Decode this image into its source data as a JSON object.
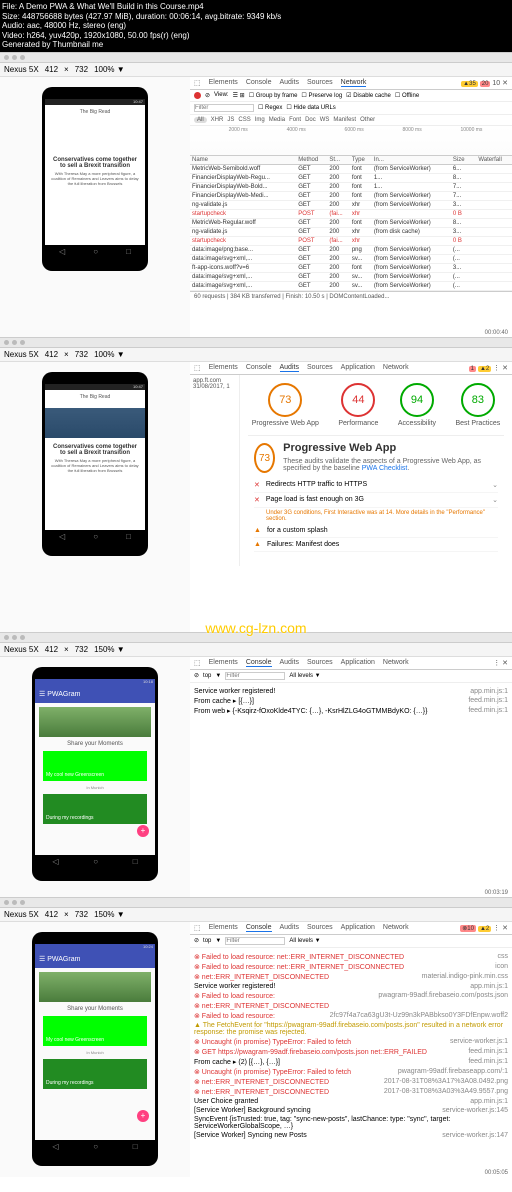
{
  "meta": {
    "file": "File: A Demo PWA & What We'll Build in this Course.mp4",
    "size": "Size: 448756688 bytes (427.97 MiB), duration: 00:06:14, avg.bitrate: 9349 kb/s",
    "audio": "Audio: aac, 48000 Hz, stereo (eng)",
    "video": "Video: h264, yuv420p, 1920x1080, 50.00 fps(r) (eng)",
    "gen": "Generated by Thumbnail me"
  },
  "toolbar": {
    "device": "Nexus 5X",
    "w": "412",
    "x": "×",
    "h": "732",
    "zoom": "100% ▼",
    "zoom150": "150% ▼"
  },
  "dt": {
    "tabs": [
      "Elements",
      "Console",
      "Audits",
      "Sources",
      "Network"
    ],
    "tabs2": [
      "Elements",
      "Console",
      "Audits",
      "Sources",
      "Application",
      "Network"
    ],
    "counts1": {
      "warn": "35",
      "err": "20",
      "cls": "10"
    },
    "counts2": {
      "warn": "2",
      "err": "1"
    },
    "counts4": {
      "err": "10",
      "warn": "2"
    },
    "filter": "Filter",
    "view": "View:",
    "group": "Group by frame",
    "preserve": "Preserve log",
    "disable": "Disable cache",
    "offline": "Offline",
    "regex": "Regex",
    "hide": "Hide data URLs",
    "types": [
      "All",
      "XHR",
      "JS",
      "CSS",
      "Img",
      "Media",
      "Font",
      "Doc",
      "WS",
      "Manifest",
      "Other"
    ],
    "tl1": "2000 ms",
    "tl2": "4000 ms",
    "tl3": "6000 ms",
    "tl4": "8000 ms",
    "tl5": "10000 ms",
    "cols": [
      "Name",
      "Method",
      "St...",
      "Type",
      "In...",
      "Size",
      "",
      "Waterfall"
    ],
    "rows": [
      {
        "n": "MetricWeb-Semibold.woff",
        "m": "GET",
        "s": "200",
        "t": "font",
        "i": "(from ServiceWorker)",
        "sz": "6..."
      },
      {
        "n": "FinancierDisplayWeb-Regu...",
        "m": "GET",
        "s": "200",
        "t": "font",
        "i": "1...",
        "sz": "8..."
      },
      {
        "n": "FinancierDisplayWeb-Bold...",
        "m": "GET",
        "s": "200",
        "t": "font",
        "i": "1...",
        "sz": "7..."
      },
      {
        "n": "FinancierDisplayWeb-Medi...",
        "m": "GET",
        "s": "200",
        "t": "font",
        "i": "(from ServiceWorker)",
        "sz": "7..."
      },
      {
        "n": "ng-validate.js",
        "m": "GET",
        "s": "200",
        "t": "xhr",
        "i": "(from ServiceWorker)",
        "sz": "3..."
      },
      {
        "n": "startupcheck",
        "m": "POST",
        "s": "(fai...",
        "t": "xhr",
        "i": "",
        "sz": "0 B",
        "red": true
      },
      {
        "n": "MetricWeb-Regular.woff",
        "m": "GET",
        "s": "200",
        "t": "font",
        "i": "(from ServiceWorker)",
        "sz": "8..."
      },
      {
        "n": "ng-validate.js",
        "m": "GET",
        "s": "200",
        "t": "xhr",
        "i": "(from disk cache)",
        "sz": "3..."
      },
      {
        "n": "startupcheck",
        "m": "POST",
        "s": "(fai...",
        "t": "xhr",
        "i": "",
        "sz": "0 B",
        "red": true
      },
      {
        "n": "data:image/png;base...",
        "m": "GET",
        "s": "200",
        "t": "png",
        "i": "(from ServiceWorker)",
        "sz": "(..."
      },
      {
        "n": "data:image/svg+xml,...",
        "m": "GET",
        "s": "200",
        "t": "sv...",
        "i": "(from ServiceWorker)",
        "sz": "(..."
      },
      {
        "n": "ft-app-icons.woff?v=6",
        "m": "GET",
        "s": "200",
        "t": "font",
        "i": "(from ServiceWorker)",
        "sz": "3..."
      },
      {
        "n": "data:image/svg+xml,...",
        "m": "GET",
        "s": "200",
        "t": "sv...",
        "i": "(from ServiceWorker)",
        "sz": "(..."
      },
      {
        "n": "data:image/svg+xml,...",
        "m": "GET",
        "s": "200",
        "t": "sv...",
        "i": "(from ServiceWorker)",
        "sz": "(..."
      }
    ],
    "summary": "60 requests | 384 KB transferred | Finish: 10.50 s | DOMContentLoaded..."
  },
  "panel1": {
    "ft_head": "The Big Read",
    "ft_title": "Conservatives come together to sell a Brexit transition",
    "ft_desc": "With Theresa May a more peripheral figure, a coalition of Remainers and Leavers aims to delay the full liberation from Brussels",
    "time": "10:47",
    "ts": "00:00:40"
  },
  "lh": {
    "url": "app.ft.com",
    "date": "31/08/2017, 1",
    "scores": [
      {
        "v": "73",
        "l": "Progressive Web App",
        "c": "c-orange"
      },
      {
        "v": "44",
        "l": "Performance",
        "c": "c-red"
      },
      {
        "v": "94",
        "l": "Accessibility",
        "c": "c-green"
      },
      {
        "v": "83",
        "l": "Best Practices",
        "c": "c-green"
      }
    ],
    "pwa_title": "Progressive Web App",
    "pwa_score": "73",
    "pwa_desc": "These audits validate the aspects of a Progressive Web App, as specified by the baseline ",
    "pwa_link": "PWA Checklist",
    "items": [
      {
        "icon": "✕",
        "cls": "x-red",
        "txt": "Redirects HTTP traffic to HTTPS"
      },
      {
        "icon": "✕",
        "cls": "x-red",
        "txt": "Page load is fast enough on 3G"
      }
    ],
    "note": "Under 3G conditions, First Interactive was at 14. More details in the \"Performance\" section.",
    "extra1": "for a custom splash",
    "extra2": "Failures: Manifest does"
  },
  "panel3": {
    "phone_title": "PWAGram",
    "time": "10:18",
    "share": "Share your Moments",
    "card1": "My cool new Greenscreen",
    "card2": "During my recordings",
    "sub": "In Munich",
    "ts": "00:03:19"
  },
  "console3": {
    "top": "top",
    "filter": "Filter",
    "levels": "All levels ▼",
    "l1": {
      "t": "Service worker registered!",
      "s": "app.min.js:1"
    },
    "l2": {
      "t": "From cache ▸ [{…}]",
      "s": "feed.min.js:1"
    },
    "l3": {
      "t": "From web ▸ {-Ksqirz-fOxoKlde4TYC: {…}, -KsrHlZLG4oGTMMBdyKO: {…}}",
      "s": "feed.min.js:1"
    }
  },
  "panel4": {
    "time": "10:24",
    "ts": "00:05:05"
  },
  "console4": {
    "lines": [
      {
        "cls": "err",
        "t": "Failed to load resource: net::ERR_INTERNET_DISCONNECTED",
        "s": "css"
      },
      {
        "cls": "err",
        "t": "Failed to load resource: net::ERR_INTERNET_DISCONNECTED",
        "s": "icon"
      },
      {
        "cls": "err",
        "t": "net::ERR_INTERNET_DISCONNECTED",
        "s": "material.indigo-pink.min.css"
      },
      {
        "cls": "",
        "t": "Service worker registered!",
        "s": "app.min.js:1"
      },
      {
        "cls": "err",
        "t": "Failed to load resource:",
        "s": "pwagram-99adf.firebaseio.com/posts.json"
      },
      {
        "cls": "err",
        "t": "net::ERR_INTERNET_DISCONNECTED",
        "s": ""
      },
      {
        "cls": "err",
        "t": "Failed to load resource:",
        "s": "2fc97f4a7ca63gU3t-Uz99n3kPABbkso0Y3FDfEnpw.woff2"
      },
      {
        "cls": "warn",
        "t": "The FetchEvent for \"https://pwagram-99adf.firebaseio.com/posts.json\" resulted in a network error response: the promise was rejected.",
        "s": ""
      },
      {
        "cls": "err",
        "t": "Uncaught (in promise) TypeError: Failed to fetch",
        "s": "service-worker.js:1"
      },
      {
        "cls": "err",
        "t": "GET https://pwagram-99adf.firebaseio.com/posts.json net::ERR_FAILED",
        "s": "feed.min.js:1"
      },
      {
        "cls": "",
        "t": "From cache ▸ (2) [{…}, {…}]",
        "s": "feed.min.js:1"
      },
      {
        "cls": "err",
        "t": "Uncaught (in promise) TypeError: Failed to fetch",
        "s": "pwagram-99adf.firebaseapp.com/:1"
      },
      {
        "cls": "err",
        "t": "net::ERR_INTERNET_DISCONNECTED",
        "s": "2017-08-31T08%3A17%3A08.0492.png"
      },
      {
        "cls": "err",
        "t": "net::ERR_INTERNET_DISCONNECTED",
        "s": "2017-08-31T08%3A03%3A49.9557.png"
      },
      {
        "cls": "",
        "t": "User Choice granted",
        "s": "app.min.js:1"
      },
      {
        "cls": "",
        "t": "[Service Worker] Background syncing",
        "s": "service-worker.js:145"
      },
      {
        "cls": "",
        "t": "SyncEvent {isTrusted: true, tag: \"sync-new-posts\", lastChance:  type: \"sync\", target: ServiceWorkerGlobalScope, …}",
        "s": ""
      },
      {
        "cls": "",
        "t": "[Service Worker] Syncing new Posts",
        "s": "service-worker.js:147"
      }
    ]
  },
  "watermark": "www.cg-lzn.com"
}
